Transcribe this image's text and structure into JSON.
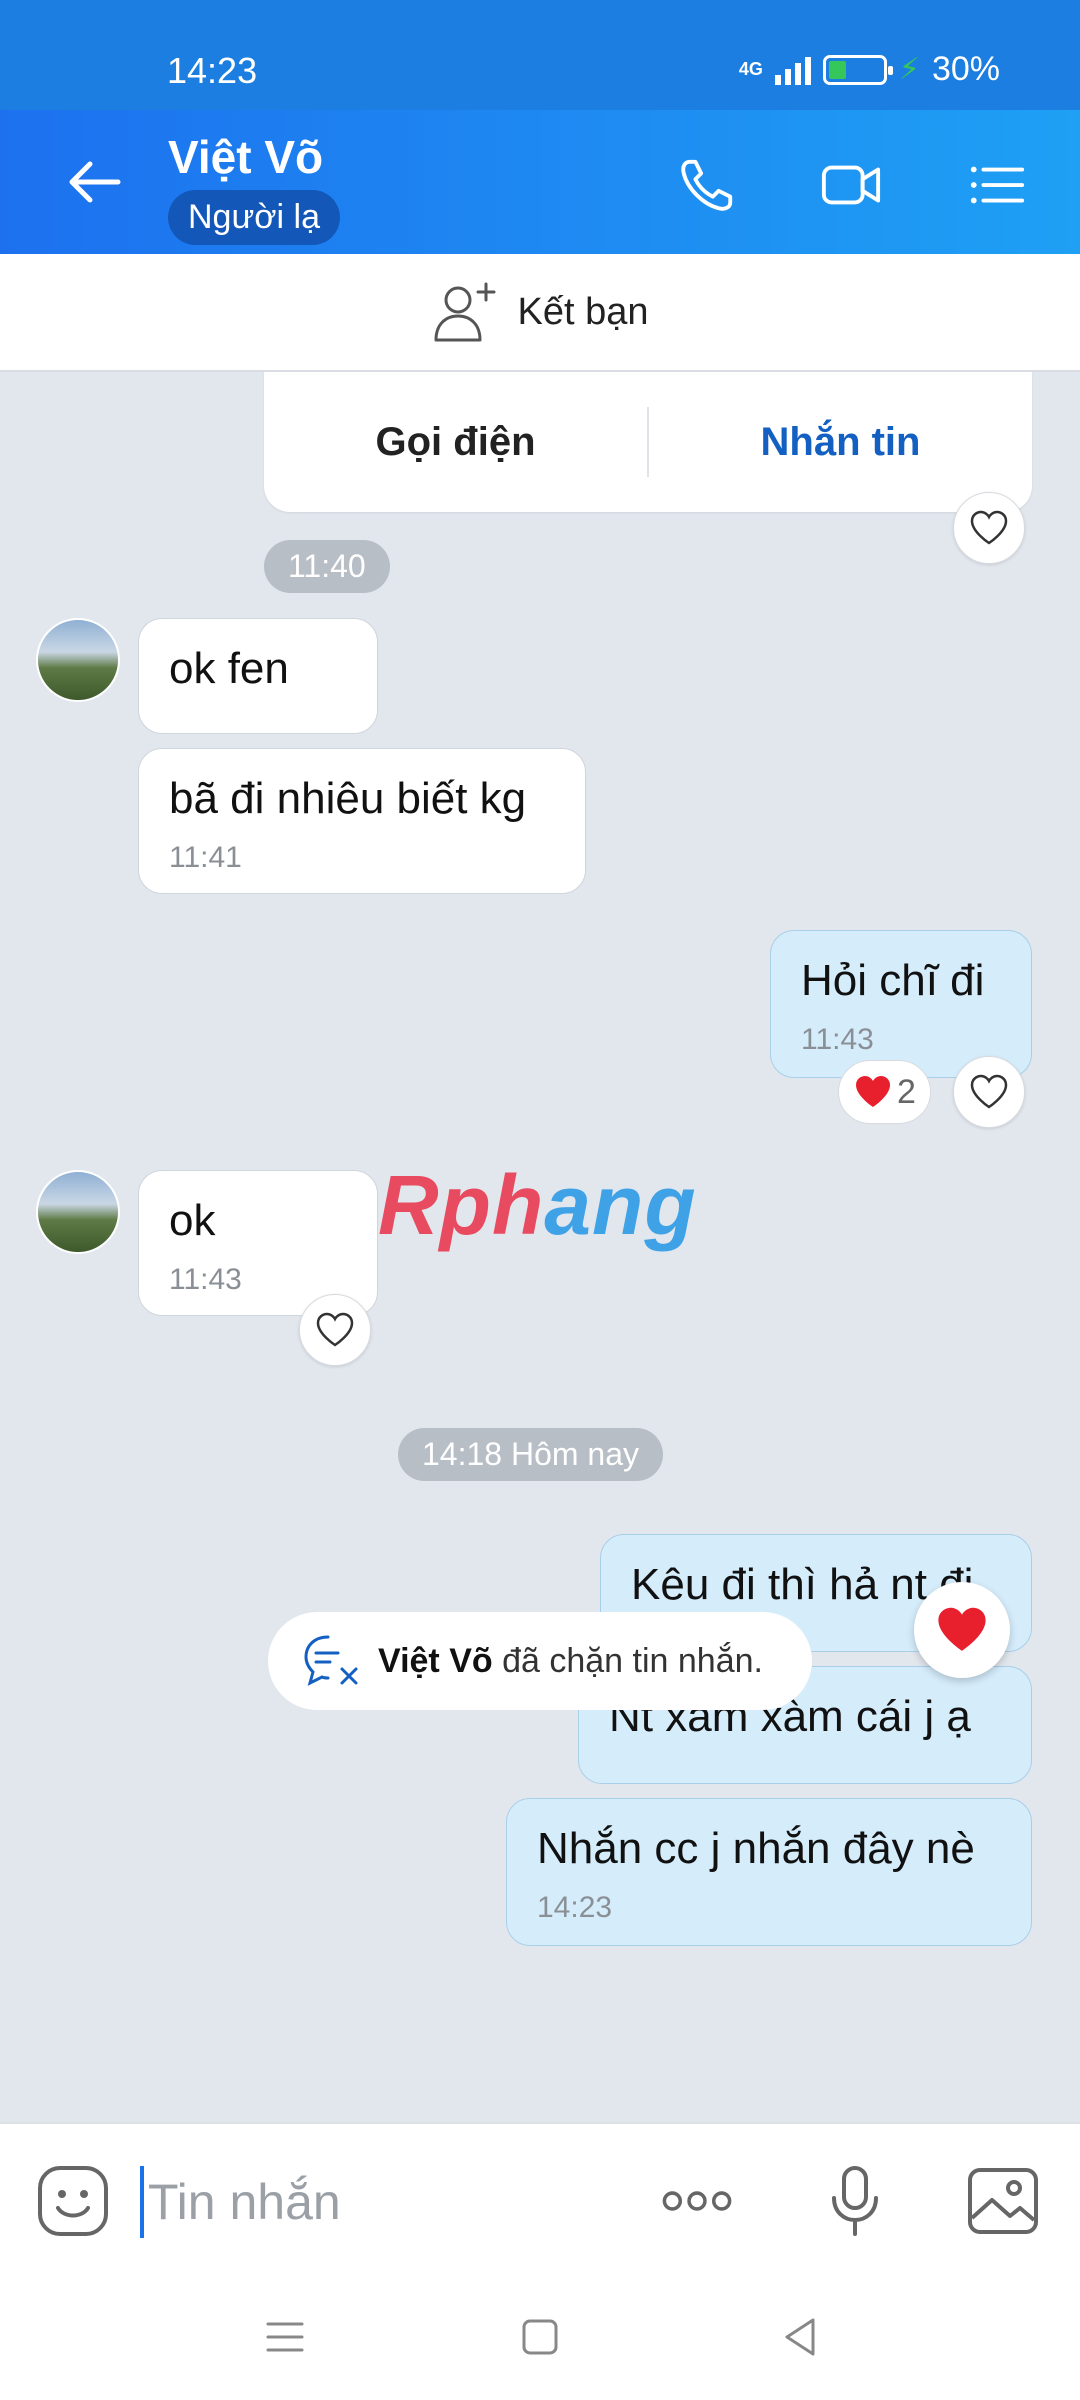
{
  "status_bar": {
    "time": "14:23",
    "network": "4G",
    "battery": "30%",
    "battery_level": 0.3
  },
  "header": {
    "contact_name": "Việt Võ",
    "badge": "Người lạ"
  },
  "add_friend": {
    "label": "Kết bạn"
  },
  "call_card": {
    "call_label": "Gọi điện",
    "message_label": "Nhắn tin"
  },
  "time_pills": [
    "11:40",
    "14:18 Hôm nay"
  ],
  "messages": [
    {
      "text": "ok fen",
      "time": ""
    },
    {
      "text": "bã đi nhiêu biết kg",
      "time": "11:41"
    },
    {
      "text": "Hỏi chĩ đi",
      "time": "11:43"
    },
    {
      "text": "ok",
      "time": "11:43"
    },
    {
      "text": "Kêu đi thì hả nt đi",
      "time": ""
    },
    {
      "text": "Nt xàm xàm cái j ạ",
      "time": ""
    },
    {
      "text": "Nhắn cc j nhắn đây nè",
      "time": "14:23"
    }
  ],
  "reaction": {
    "count": "2"
  },
  "watermark": {
    "left": "Rph",
    "right": "ang"
  },
  "blocked_notice": {
    "name": "Việt Võ",
    "text": " đã chặn tin nhắn."
  },
  "input": {
    "placeholder": "Tin nhắn"
  },
  "colors": {
    "header": "#1d71ef",
    "my_bubble": "#d5ecfb",
    "accent": "#1460c2",
    "heart": "#e8202e"
  },
  "icons": [
    "back-arrow-icon",
    "phone-icon",
    "video-call-icon",
    "menu-icon",
    "add-friend-icon",
    "heart-icon",
    "emoji-icon",
    "more-icon",
    "microphone-icon",
    "image-icon",
    "blocked-message-icon"
  ]
}
